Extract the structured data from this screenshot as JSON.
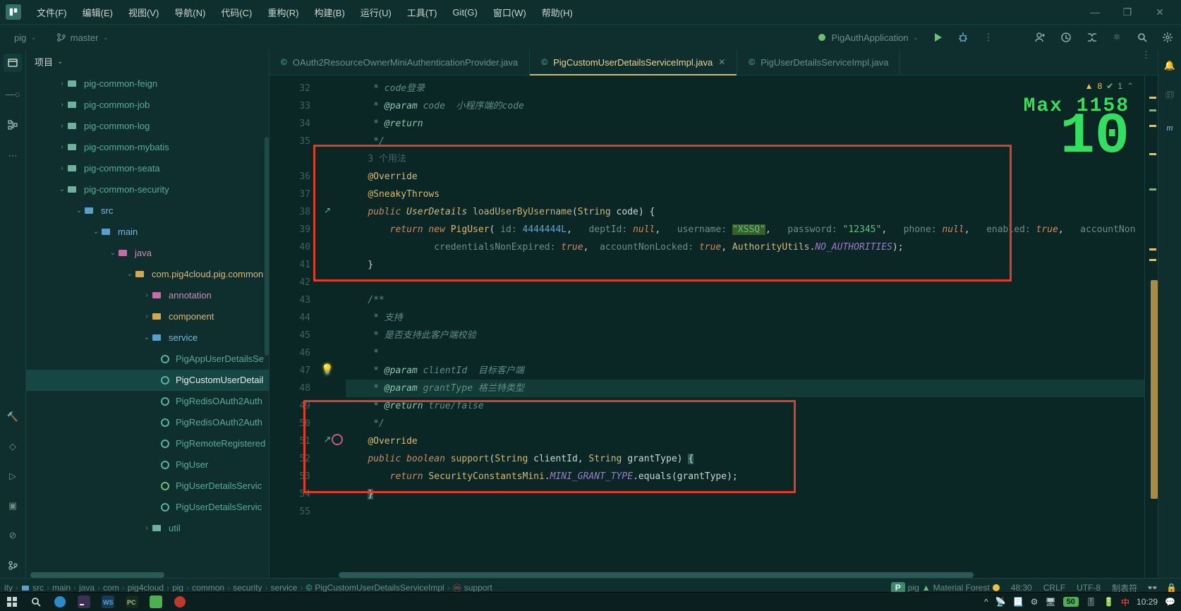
{
  "menu": {
    "items": [
      "文件(F)",
      "编辑(E)",
      "视图(V)",
      "导航(N)",
      "代码(C)",
      "重构(R)",
      "构建(B)",
      "运行(U)",
      "工具(T)",
      "Git(G)",
      "窗口(W)",
      "帮助(H)"
    ]
  },
  "toolbar": {
    "project": "pig",
    "branch": "master",
    "runConfig": "PigAuthApplication"
  },
  "sidebar": {
    "header": "项目",
    "tree_html": "<div class='node' style='padding-left:44px'><span class='arrow'>›</span><svg class='icon' width='16' height='16'><rect class='folder-ic' x='1' y='4' width='12' height='9' rx='1'/></svg><span class='label'>pig-common-feign</span></div><div class='node' style='padding-left:44px'><span class='arrow'>›</span><svg class='icon' width='16' height='16'><rect class='folder-ic' x='1' y='4' width='12' height='9' rx='1'/></svg><span class='label'>pig-common-job</span></div><div class='node' style='padding-left:44px'><span class='arrow'>›</span><svg class='icon' width='16' height='16'><rect class='folder-ic' x='1' y='4' width='12' height='9' rx='1'/></svg><span class='label'>pig-common-log</span></div><div class='node' style='padding-left:44px'><span class='arrow'>›</span><svg class='icon' width='16' height='16'><rect class='folder-ic' x='1' y='4' width='12' height='9' rx='1'/></svg><span class='label'>pig-common-mybatis</span></div><div class='node' style='padding-left:44px'><span class='arrow'>›</span><svg class='icon' width='16' height='16'><rect class='folder-ic' x='1' y='4' width='12' height='9' rx='1'/></svg><span class='label'>pig-common-seata</span></div><div class='node' style='padding-left:44px'><span class='arrow'>⌄</span><svg class='icon' width='16' height='16'><rect class='folder-ic' x='1' y='4' width='12' height='9' rx='1'/></svg><span class='label'>pig-common-security</span></div><div class='node' style='padding-left:68px'><span class='arrow'>⌄</span><svg class='icon' width='16' height='16'><rect fill='#5aa0c8' x='1' y='4' width='12' height='9' rx='1'/></svg><span class='label' style='color:#7fb8d6'>src</span></div><div class='node' style='padding-left:92px'><span class='arrow'>⌄</span><svg class='icon' width='16' height='16'><rect fill='#5aa0c8' x='1' y='4' width='12' height='9' rx='1'/></svg><span class='label' style='color:#7fb8d6'>main</span></div><div class='node' style='padding-left:116px'><span class='arrow'>⌄</span><svg class='icon' width='16' height='16'><rect fill='#c170a5' x='1' y='4' width='12' height='9' rx='1'/></svg><span class='label' style='color:#c68fb4'>java</span></div><div class='node' style='padding-left:140px'><span class='arrow'>⌄</span><svg class='icon' width='16' height='16'><rect fill='#d0a85a' x='1' y='4' width='12' height='9' rx='1'/></svg><span class='label' style='color:#d4b880'>com.pig4cloud.pig.common</span></div><div class='node' style='padding-left:164px'><span class='arrow'>›</span><svg class='icon' width='16' height='16'><rect fill='#c170a5' x='1' y='4' width='12' height='9' rx='1'/></svg><span class='label' style='color:#c68fb4'>annotation</span></div><div class='node' style='padding-left:164px'><span class='arrow'>›</span><svg class='icon' width='16' height='16'><rect fill='#d0a85a' x='1' y='4' width='12' height='9' rx='1'/></svg><span class='label' style='color:#d4b880'>component</span></div><div class='node' style='padding-left:164px'><span class='arrow'>⌄</span><svg class='icon' width='16' height='16'><rect fill='#5aa0c8' x='1' y='4' width='12' height='9' rx='1'/></svg><span class='label' style='color:#7fb8d6'>service</span></div><div class='node' style='padding-left:188px'><span class='icon'><svg width='14' height='14'><circle class='circle-ic' cx='7' cy='7' r='5'/></svg></span><span class='label'>PigAppUserDetailsSe</span></div><div class='node sel' style='padding-left:188px'><span class='icon'><svg width='14' height='14'><circle class='circle-ic' cx='7' cy='7' r='5'/></svg></span><span class='label'>PigCustomUserDetail</span></div><div class='node' style='padding-left:188px'><span class='icon'><svg width='14' height='14'><circle class='circle-ic' cx='7' cy='7' r='5'/></svg></span><span class='label'>PigRedisOAuth2Auth</span></div><div class='node' style='padding-left:188px'><span class='icon'><svg width='14' height='14'><circle class='circle-ic' cx='7' cy='7' r='5'/></svg></span><span class='label'>PigRedisOAuth2Auth</span></div><div class='node' style='padding-left:188px'><span class='icon'><svg width='14' height='14'><circle class='circle-ic' cx='7' cy='7' r='5'/></svg></span><span class='label'>PigRemoteRegistered</span></div><div class='node' style='padding-left:188px'><span class='icon'><svg width='14' height='14'><circle class='circle-ic' cx='7' cy='7' r='5'/></svg></span><span class='label'>PigUser</span></div><div class='node' style='padding-left:188px'><span class='icon'><svg width='14' height='14'><circle class='circle-ic circle-ic-green' cx='7' cy='7' r='5'/></svg></span><span class='label'>PigUserDetailsServic</span></div><div class='node' style='padding-left:188px'><span class='icon'><svg width='14' height='14'><circle class='circle-ic' cx='7' cy='7' r='5'/></svg></span><span class='label'>PigUserDetailsServic</span></div><div class='node' style='padding-left:164px'><span class='arrow'>›</span><svg class='icon' width='16' height='16'><rect class='folder-ic' x='1' y='4' width='12' height='9' rx='1'/></svg><span class='label'>util</span></div>"
  },
  "tabs": [
    {
      "icon": "©",
      "name": "OAuth2ResourceOwnerMiniAuthenticationProvider.java",
      "active": false,
      "close": false
    },
    {
      "icon": "©",
      "name": "PigCustomUserDetailsServiceImpl.java",
      "active": true,
      "close": true
    },
    {
      "icon": "©",
      "name": "PigUserDetailsServiceImpl.java",
      "active": false,
      "close": false
    }
  ],
  "gutter": [
    "32",
    "33",
    "34",
    "35",
    "",
    "36",
    "37",
    "38",
    "39",
    "40",
    "41",
    "42",
    "43",
    "44",
    "45",
    "46",
    "47",
    "48",
    "49",
    "50",
    "51",
    "52",
    "53",
    "54",
    "55"
  ],
  "overlay": {
    "max": "Max  1158",
    "big": "10"
  },
  "inspections": {
    "warn": "8",
    "ok": "1"
  },
  "breadcrumb": [
    "ity",
    "src",
    "main",
    "java",
    "com",
    "pig4cloud",
    "pig",
    "common",
    "security",
    "service",
    "PigCustomUserDetailsServiceImpl",
    "support"
  ],
  "status": {
    "proj": "pig",
    "theme": "Material Forest",
    "pos": "48:30",
    "eol": "CRLF",
    "enc": "UTF-8",
    "tabs": "制表符"
  },
  "taskbarTime": "10:29"
}
